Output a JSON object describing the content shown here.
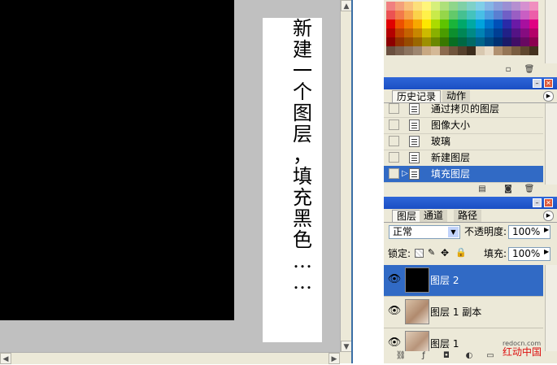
{
  "canvas": {
    "note_chars": [
      "新",
      "建",
      "一",
      "个",
      "图",
      "层",
      "，",
      "填",
      "充",
      "黑",
      "色",
      "…",
      "…"
    ],
    "layer_color": "#000000"
  },
  "swatches": {
    "colors": [
      [
        "#f08080",
        "#f4a07a",
        "#f9c07a",
        "#fcdf7a",
        "#fff57a",
        "#d6ef7a",
        "#aee07a",
        "#8fd68a",
        "#7fd0a6",
        "#7ed1c8",
        "#7fcfe8",
        "#84b5e6",
        "#8a9ddb",
        "#9b8fd3",
        "#b58fd0",
        "#d590d0",
        "#f08fbf"
      ],
      [
        "#eb5252",
        "#f27a4a",
        "#f6a34a",
        "#fbd24a",
        "#fff14a",
        "#c9ea4a",
        "#95d64a",
        "#63c96a",
        "#45c091",
        "#44c3bd",
        "#48bfe6",
        "#4f9ee0",
        "#5a7fd1",
        "#705fc6",
        "#9a5ec3",
        "#c95ec3",
        "#ec5ea9"
      ],
      [
        "#e00000",
        "#ed5000",
        "#f27a00",
        "#f7a800",
        "#fde700",
        "#abdb00",
        "#5ec400",
        "#1ab43a",
        "#00a86a",
        "#00a9a3",
        "#00a3dc",
        "#0076cc",
        "#0050b8",
        "#2a2aa8",
        "#6a1aa6",
        "#a8109f",
        "#e00082"
      ],
      [
        "#b40000",
        "#bf3f00",
        "#c46200",
        "#c88700",
        "#cdba00",
        "#89b000",
        "#4a9c00",
        "#0d8f2e",
        "#008756",
        "#008a85",
        "#0082b3",
        "#005ea6",
        "#003f94",
        "#212187",
        "#541385",
        "#860c80",
        "#b40068"
      ],
      [
        "#8c0000",
        "#933000",
        "#974b00",
        "#9a6700",
        "#9e9000",
        "#6a8800",
        "#397800",
        "#086e22",
        "#006843",
        "#006a66",
        "#00648a",
        "#004880",
        "#003072",
        "#1a1a68",
        "#410e66",
        "#680962",
        "#8c0050"
      ],
      [
        "#6a5040",
        "#7b6250",
        "#8c7460",
        "#9d8670",
        "#c8a882",
        "#d4b896",
        "#8c6a4e",
        "#70543c",
        "#56402c",
        "#3c2c1c",
        "#d8c8b0",
        "#e8dcc8",
        "#b09070",
        "#957555",
        "#7a5d40",
        "#5f472e",
        "#44311e"
      ]
    ]
  },
  "history": {
    "tabs": [
      "历史记录",
      "动作"
    ],
    "items": [
      {
        "label": "通过拷贝的图层",
        "selected": false
      },
      {
        "label": "图像大小",
        "selected": false
      },
      {
        "label": "玻璃",
        "selected": false
      },
      {
        "label": "新建图层",
        "selected": false
      },
      {
        "label": "填充图层",
        "selected": true
      }
    ]
  },
  "layers": {
    "tabs": [
      "图层",
      "通道",
      "路径"
    ],
    "blend_mode": "正常",
    "opacity_label": "不透明度:",
    "opacity_value": "100%",
    "lock_label": "锁定:",
    "fill_label": "填充:",
    "fill_value": "100%",
    "items": [
      {
        "label": "图层 2",
        "selected": true
      },
      {
        "label": "图层 1 副本",
        "selected": false
      },
      {
        "label": "图层 1",
        "selected": false
      }
    ]
  },
  "watermark": {
    "text": "红动中国",
    "url": "redocn.com"
  }
}
